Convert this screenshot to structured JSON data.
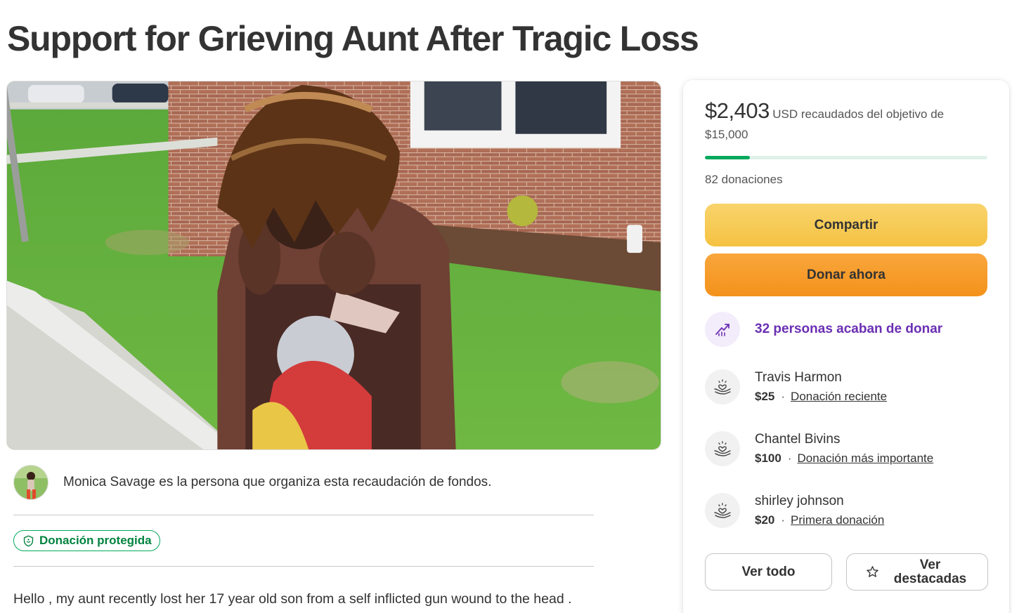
{
  "page": {
    "title": "Support for Grieving Aunt After Tragic Loss"
  },
  "hero": {
    "image": "photo-teen-with-dreadlocks-on-lawn"
  },
  "organizer": {
    "text": "Monica Savage es la persona que organiza esta recaudación de fondos."
  },
  "badge": {
    "label": "Donación protegida",
    "icon": "shield-icon"
  },
  "story": {
    "first_line": "Hello , my aunt recently lost her 17 year old son from a self inflicted gun wound to the head ."
  },
  "sidebar": {
    "raised": "$2,403",
    "raised_suffix": "USD recaudados del objetivo de",
    "goal": "$15,000",
    "progress_fraction": 0.16,
    "donation_count": "82 donaciones",
    "share_label": "Compartir",
    "donate_label": "Donar ahora",
    "momentum_text": "32 personas acaban de donar",
    "momentum_icon": "trending-up-icon",
    "donors": [
      {
        "name": "Travis Harmon",
        "amount": "$25",
        "tag": "Donación reciente"
      },
      {
        "name": "Chantel Bivins",
        "amount": "$100",
        "tag": "Donación más importante"
      },
      {
        "name": "shirley johnson",
        "amount": "$20",
        "tag": "Primera donación"
      }
    ],
    "see_all_label": "Ver todo",
    "see_top_label": "Ver destacadas"
  },
  "colors": {
    "brand_green": "#02a95c",
    "share_yellow": "#f5c242",
    "donate_orange": "#f3921b",
    "momentum_purple": "#6b2fb3"
  }
}
